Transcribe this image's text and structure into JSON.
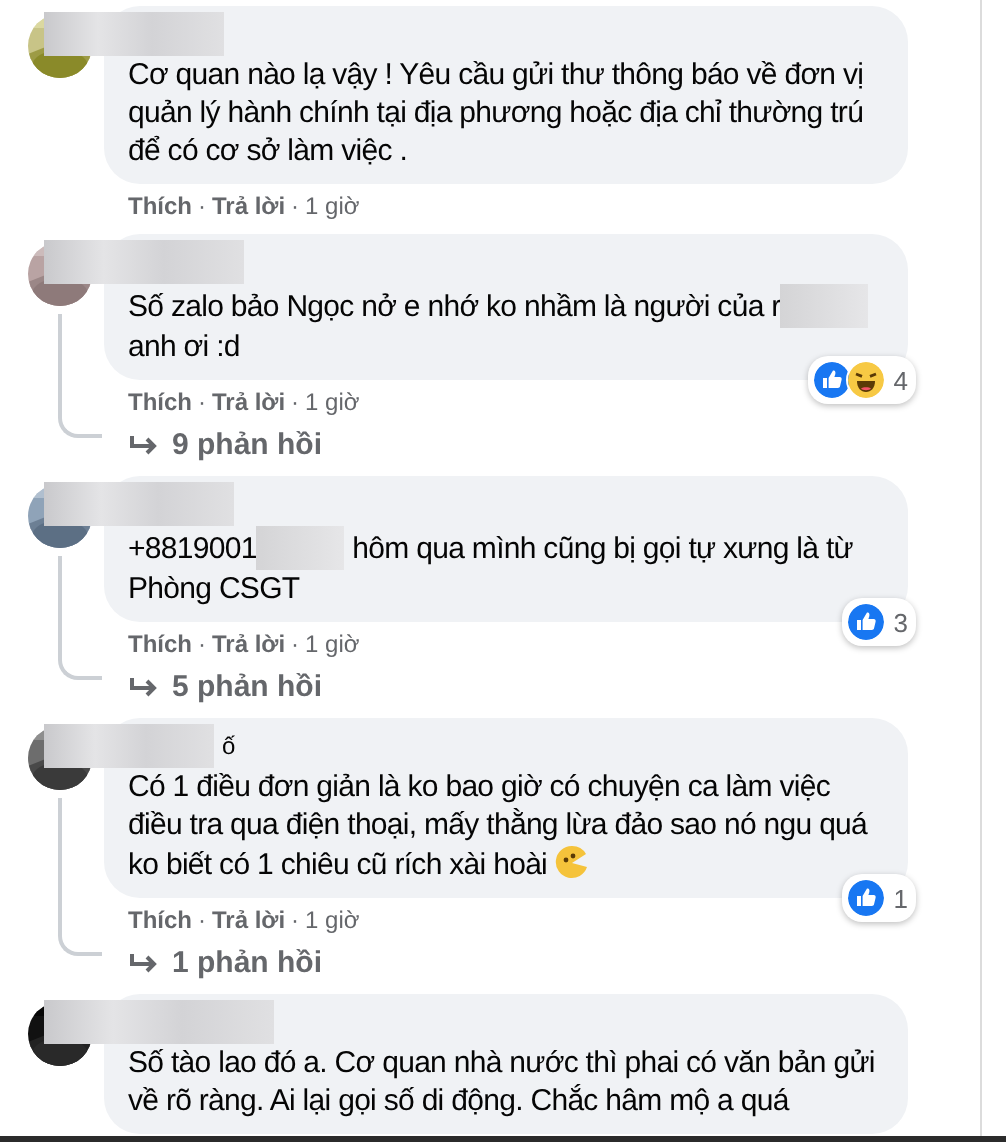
{
  "comments": [
    {
      "avatar": {
        "kind": "picture"
      },
      "body": [
        {
          "kind": "text",
          "text": "Cơ quan nào lạ vậy ! Yêu cầu gửi thư thông báo về đơn vị quản lý hành chính tại địa phương hoặc địa chỉ thường trú để có cơ sở làm việc ."
        }
      ],
      "actions": {
        "like": "Thích",
        "separator": "·",
        "reply": "Trả lời",
        "separator_2": "·",
        "time": "1 giờ"
      }
    },
    {
      "avatar": {
        "kind": "picture"
      },
      "body": [
        {
          "kind": "text",
          "text": "Số zalo bảo Ngọc nở e nhớ ko nhầm là người của r"
        },
        {
          "kind": "redacted"
        },
        {
          "kind": "text",
          "text": " anh ơi :d"
        }
      ],
      "reactions": {
        "icons": [
          {
            "kind": "like"
          },
          {
            "kind": "haha"
          }
        ],
        "count": "4"
      },
      "actions": {
        "like": "Thích",
        "separator": "·",
        "reply": "Trả lời",
        "separator_2": "·",
        "time": "1 giờ"
      },
      "replies": "9 phản hồi"
    },
    {
      "avatar": {
        "kind": "picture"
      },
      "body": [
        {
          "kind": "text",
          "text": "+8819001"
        },
        {
          "kind": "redacted"
        },
        {
          "kind": "text",
          "text": " hôm qua mình cũng bị gọi tự xưng là từ Phòng CSGT"
        }
      ],
      "reactions": {
        "icons": [
          {
            "kind": "like"
          }
        ],
        "count": "3"
      },
      "actions": {
        "like": "Thích",
        "separator": "·",
        "reply": "Trả lời",
        "separator_2": "·",
        "time": "1 giờ"
      },
      "replies": "5 phản hồi"
    },
    {
      "avatar": {
        "kind": "picture"
      },
      "name_fragment": "ố",
      "body": [
        {
          "kind": "text",
          "text": "Có 1 điều đơn giản là ko bao giờ có chuyện ca làm việc điều tra qua điện thoại, mấy thằng lừa đảo sao nó ngu quá ko biết có 1 chiêu cũ rích xài hoài"
        },
        {
          "kind": "emoji"
        }
      ],
      "reactions": {
        "icons": [
          {
            "kind": "like"
          }
        ],
        "count": "1"
      },
      "actions": {
        "like": "Thích",
        "separator": "·",
        "reply": "Trả lời",
        "separator_2": "·",
        "time": "1 giờ"
      },
      "replies": "1 phản hồi"
    },
    {
      "avatar": {
        "kind": "picture"
      },
      "body": [
        {
          "kind": "text",
          "text": "Số tào lao đó a. Cơ quan nhà nước thì phai có văn bản gửi về rõ ràng. Ai lại gọi số di động. Chắc hâm mộ a quá"
        }
      ]
    }
  ]
}
